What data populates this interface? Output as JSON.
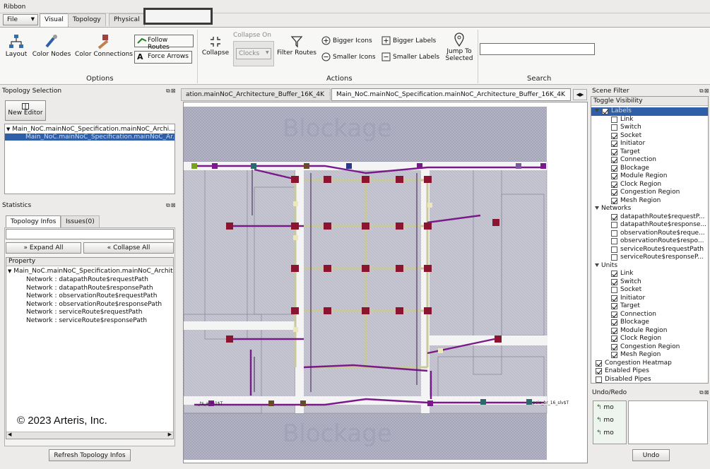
{
  "ribbon": {
    "label": "Ribbon",
    "file_label": "File",
    "tabs": [
      "Visual",
      "Topology",
      "Physical"
    ],
    "buttons": {
      "layout": "Layout",
      "color_nodes": "Color Nodes",
      "color_connections": "Color Connections",
      "follow_routes": "Follow Routes",
      "force_arrows": "Force Arrows",
      "collapse": "Collapse",
      "collapse_on": "Collapse On",
      "collapse_on_value": "Clocks",
      "filter_routes": "Filter Routes",
      "bigger_icons": "Bigger Icons",
      "smaller_icons": "Smaller Icons",
      "bigger_labels": "Bigger Labels",
      "smaller_labels": "Smaller Labels",
      "jump_to_selected": "Jump To Selected"
    },
    "search_value": "",
    "groups": [
      "Options",
      "Actions",
      "Search"
    ]
  },
  "topology_selection": {
    "title": "Topology Selection",
    "new_editor": "New Editor",
    "items": [
      "Main_NoC.mainNoC_Specification.mainNoC_Archi...",
      "Main_NoC.mainNoC_Specification.mainNoC_Ar..."
    ]
  },
  "statistics": {
    "title": "Statistics",
    "tabs": [
      "Topology Infos",
      "Issues(0)"
    ],
    "filter_value": "",
    "expand_all": "Expand All",
    "collapse_all": "Collapse All",
    "column": "Property",
    "root": "Main_NoC.mainNoC_Specification.mainNoC_Architec",
    "rows": [
      "Network : datapathRoute$requestPath",
      "Network : datapathRoute$responsePath",
      "Network : observationRoute$requestPath",
      "Network : observationRoute$responsePath",
      "Network : serviceRoute$requestPath",
      "Network : serviceRoute$responsePath"
    ],
    "copyright": "© 2023 Arteris, Inc.",
    "refresh": "Refresh Topology Infos"
  },
  "editor": {
    "tabs": [
      "ation.mainNoC_Architecture_Buffer_16K_4K",
      "Main_NoC.mainNoC_Specification.mainNoC_Architecture_Buffer_16K_4K"
    ],
    "close_glyph": "✖",
    "blockage_label": "Blockage",
    "node_label_left": "_ts_a_m1$T",
    "node_label_right": "pcie_br_16_slv$T"
  },
  "scene_filter": {
    "title": "Scene Filter",
    "toggle_visibility": "Toggle Visibility",
    "rows": [
      {
        "label": "Labels",
        "level": 1,
        "checked": true,
        "expand": true,
        "selected": true
      },
      {
        "label": "Link",
        "level": 2,
        "checked": false
      },
      {
        "label": "Switch",
        "level": 2,
        "checked": false
      },
      {
        "label": "Socket",
        "level": 2,
        "checked": true
      },
      {
        "label": "Initiator",
        "level": 2,
        "checked": true
      },
      {
        "label": "Target",
        "level": 2,
        "checked": true
      },
      {
        "label": "Connection",
        "level": 2,
        "checked": true
      },
      {
        "label": "Blockage",
        "level": 2,
        "checked": true
      },
      {
        "label": "Module Region",
        "level": 2,
        "checked": true
      },
      {
        "label": "Clock Region",
        "level": 2,
        "checked": true
      },
      {
        "label": "Congestion Region",
        "level": 2,
        "checked": true
      },
      {
        "label": "Mesh Region",
        "level": 2,
        "checked": true
      },
      {
        "label": "Networks",
        "level": 1,
        "checked": null,
        "expand": true
      },
      {
        "label": "datapathRoute$requestP...",
        "level": 2,
        "checked": true
      },
      {
        "label": "datapathRoute$response...",
        "level": 2,
        "checked": false
      },
      {
        "label": "observationRoute$reque...",
        "level": 2,
        "checked": false
      },
      {
        "label": "observationRoute$respo...",
        "level": 2,
        "checked": false
      },
      {
        "label": "serviceRoute$requestPath",
        "level": 2,
        "checked": false
      },
      {
        "label": "serviceRoute$responseP...",
        "level": 2,
        "checked": false
      },
      {
        "label": "Units",
        "level": 1,
        "checked": null,
        "expand": true
      },
      {
        "label": "Link",
        "level": 2,
        "checked": true
      },
      {
        "label": "Switch",
        "level": 2,
        "checked": true
      },
      {
        "label": "Socket",
        "level": 2,
        "checked": false
      },
      {
        "label": "Initiator",
        "level": 2,
        "checked": true
      },
      {
        "label": "Target",
        "level": 2,
        "checked": true
      },
      {
        "label": "Connection",
        "level": 2,
        "checked": true
      },
      {
        "label": "Blockage",
        "level": 2,
        "checked": true
      },
      {
        "label": "Module Region",
        "level": 2,
        "checked": true
      },
      {
        "label": "Clock Region",
        "level": 2,
        "checked": true
      },
      {
        "label": "Congestion Region",
        "level": 2,
        "checked": true
      },
      {
        "label": "Mesh Region",
        "level": 2,
        "checked": true
      },
      {
        "label": "Congestion Heatmap",
        "level": 0,
        "checked": true
      },
      {
        "label": "Enabled Pipes",
        "level": 0,
        "checked": true
      },
      {
        "label": "Disabled Pipes",
        "level": 0,
        "checked": false
      }
    ]
  },
  "undo_redo": {
    "title": "Undo/Redo",
    "items": [
      "mo",
      "mo",
      "mo"
    ],
    "undo": "Undo"
  },
  "colors": {
    "route": "#7a1a8a",
    "router": "#8a1530",
    "link": "#c8c890",
    "blockage": "#b4b4c6",
    "selection": "#2f5fa8"
  }
}
